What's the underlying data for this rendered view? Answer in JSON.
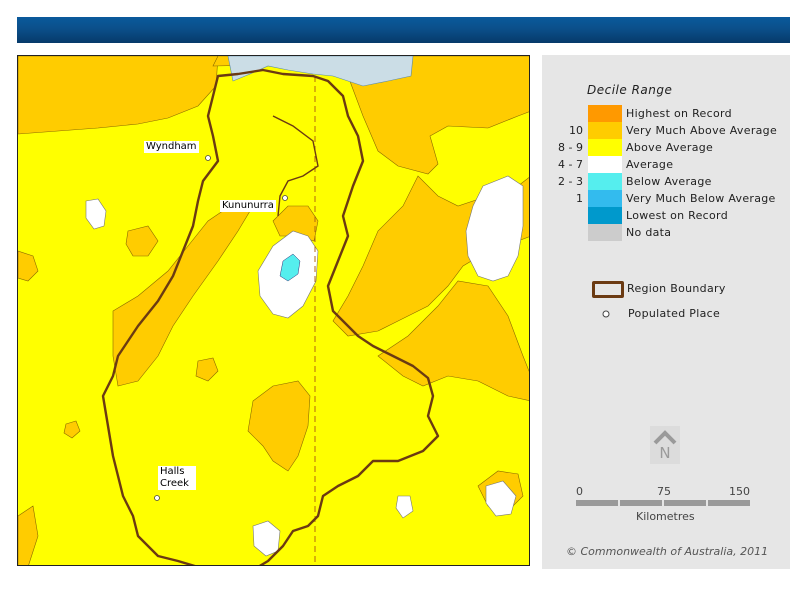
{
  "legend": {
    "title": "Decile Range",
    "items": [
      {
        "range": "",
        "label": "Highest on Record",
        "color": "#ff9900"
      },
      {
        "range": "10",
        "label": "Very Much Above Average",
        "color": "#ffcc00"
      },
      {
        "range": "8 - 9",
        "label": "Above Average",
        "color": "#ffff00"
      },
      {
        "range": "4 - 7",
        "label": "Average",
        "color": "#ffffff"
      },
      {
        "range": "2 - 3",
        "label": "Below Average",
        "color": "#55eeee"
      },
      {
        "range": "1",
        "label": "Very Much Below Average",
        "color": "#33bbee"
      },
      {
        "range": "",
        "label": "Lowest on Record",
        "color": "#0099cc"
      },
      {
        "range": "",
        "label": "No data",
        "color": "#cccccc"
      }
    ],
    "boundary_label": "Region Boundary",
    "boundary_color": "#6b3a12",
    "place_label": "Populated Place"
  },
  "map": {
    "towns": [
      {
        "name": "Wyndham"
      },
      {
        "name": "Kununurra"
      },
      {
        "name": "Halls Creek"
      }
    ],
    "sea_color": "#cbdde6"
  },
  "north_arrow": {
    "letter": "N",
    "icon": "north-arrow-icon"
  },
  "scale_bar": {
    "ticks": [
      "0",
      "75",
      "150"
    ],
    "unit": "Kilometres"
  },
  "copyright": "© Commonwealth of Australia, 2011"
}
